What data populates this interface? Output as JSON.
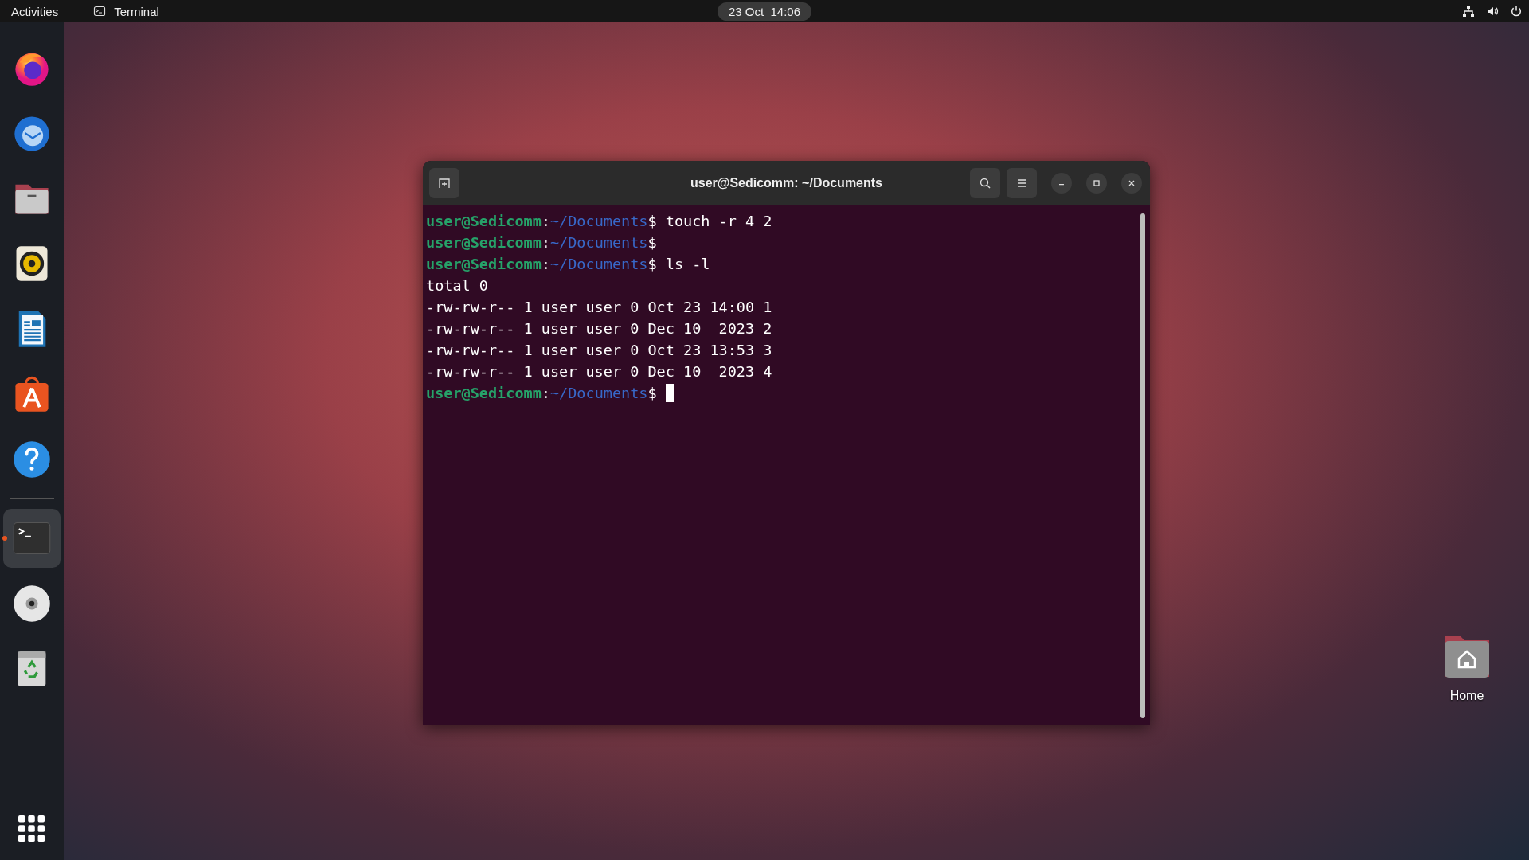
{
  "top_bar": {
    "activities": "Activities",
    "app_name": "Terminal",
    "clock": "23 Oct  14:06"
  },
  "dock": {
    "items": [
      {
        "kind": "firefox",
        "active": false
      },
      {
        "kind": "thunderbird",
        "active": false
      },
      {
        "kind": "files",
        "active": false
      },
      {
        "kind": "rhythmbox",
        "active": false
      },
      {
        "kind": "writer",
        "active": false
      },
      {
        "kind": "appcenter",
        "active": false
      },
      {
        "kind": "help",
        "active": false
      },
      {
        "kind": "separator",
        "active": false
      },
      {
        "kind": "terminal",
        "active": true
      },
      {
        "kind": "disc",
        "active": false
      },
      {
        "kind": "trash",
        "active": false
      }
    ]
  },
  "desktop_icons": [
    {
      "label": "Home"
    }
  ],
  "terminal_window": {
    "title": "user@Sedicomm: ~/Documents",
    "lines": [
      {
        "kind": "prompt",
        "user": "user@Sedicomm",
        "sep": ":",
        "path": "~/Documents",
        "dollar": "$",
        "command": " touch -r 4 2",
        "cursor": false
      },
      {
        "kind": "prompt",
        "user": "user@Sedicomm",
        "sep": ":",
        "path": "~/Documents",
        "dollar": "$",
        "cursor": false
      },
      {
        "kind": "prompt",
        "user": "user@Sedicomm",
        "sep": ":",
        "path": "~/Documents",
        "dollar": "$",
        "command": " ls -l",
        "cursor": false
      },
      {
        "kind": "output",
        "text": "total 0"
      },
      {
        "kind": "output",
        "text": "-rw-rw-r-- 1 user user 0 Oct 23 14:00 1"
      },
      {
        "kind": "output",
        "text": "-rw-rw-r-- 1 user user 0 Dec 10  2023 2"
      },
      {
        "kind": "output",
        "text": "-rw-rw-r-- 1 user user 0 Oct 23 13:53 3"
      },
      {
        "kind": "output",
        "text": "-rw-rw-r-- 1 user user 0 Dec 10  2023 4"
      },
      {
        "kind": "prompt",
        "user": "user@Sedicomm",
        "sep": ":",
        "path": "~/Documents",
        "dollar": "$",
        "cursor": true
      }
    ]
  }
}
